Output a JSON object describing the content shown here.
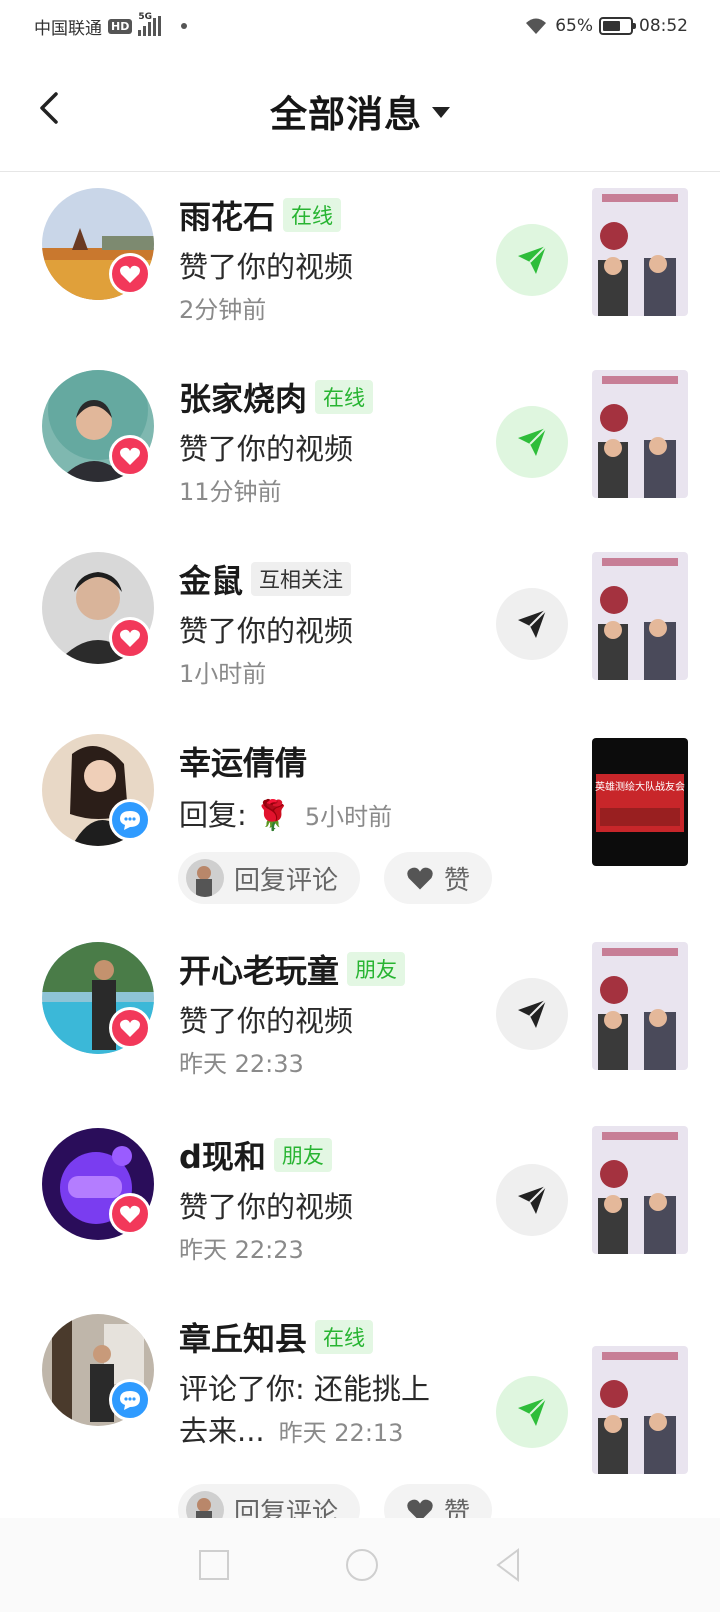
{
  "status_bar": {
    "carrier": "中国联通",
    "hd": "HD",
    "network": "5G",
    "wifi_icon": "wifi-icon",
    "battery_percent": "65%",
    "battery_level": 0.65,
    "time": "08:52"
  },
  "header": {
    "back_icon": "back-chevron-icon",
    "title": "全部消息",
    "dropdown_icon": "caret-down-icon"
  },
  "colors": {
    "online_green": "#28b432",
    "heart_red": "#f2385a",
    "comment_blue": "#2f9bff"
  },
  "messages": [
    {
      "name": "雨花石",
      "tag": "在线",
      "action": "赞了你的视频",
      "time": "2分钟前",
      "badge": "heart-icon",
      "send": "green"
    },
    {
      "name": "张家烧肉",
      "tag": "在线",
      "action": "赞了你的视频",
      "time": "11分钟前",
      "badge": "heart-icon",
      "send": "green"
    },
    {
      "name": "金鼠",
      "tag": "互相关注",
      "action": "赞了你的视频",
      "time": "1小时前",
      "badge": "heart-icon",
      "send": "gray"
    },
    {
      "name": "幸运倩倩",
      "action": "回复:",
      "emoji": "🌹",
      "time": "5小时前",
      "badge": "comment-icon",
      "reply_label": "回复评论",
      "like_label": "赞",
      "thumb_text": "英雄测绘大队战友会"
    },
    {
      "name": "开心老玩童",
      "tag": "朋友",
      "action": "赞了你的视频",
      "time": "昨天 22:33",
      "badge": "heart-icon",
      "send": "gray"
    },
    {
      "name": "d现和",
      "tag": "朋友",
      "action": "赞了你的视频",
      "time": "昨天 22:23",
      "badge": "heart-icon",
      "send": "gray"
    },
    {
      "name": "章丘知县",
      "tag": "在线",
      "action_line1": "评论了你: 还能挑上",
      "action_line2": "去来...",
      "time": "昨天 22:13",
      "badge": "comment-icon",
      "send": "green",
      "reply_label": "回复评论",
      "like_label": "赞"
    }
  ],
  "nav_bar": [
    "recent-apps-icon",
    "home-icon",
    "back-icon"
  ]
}
